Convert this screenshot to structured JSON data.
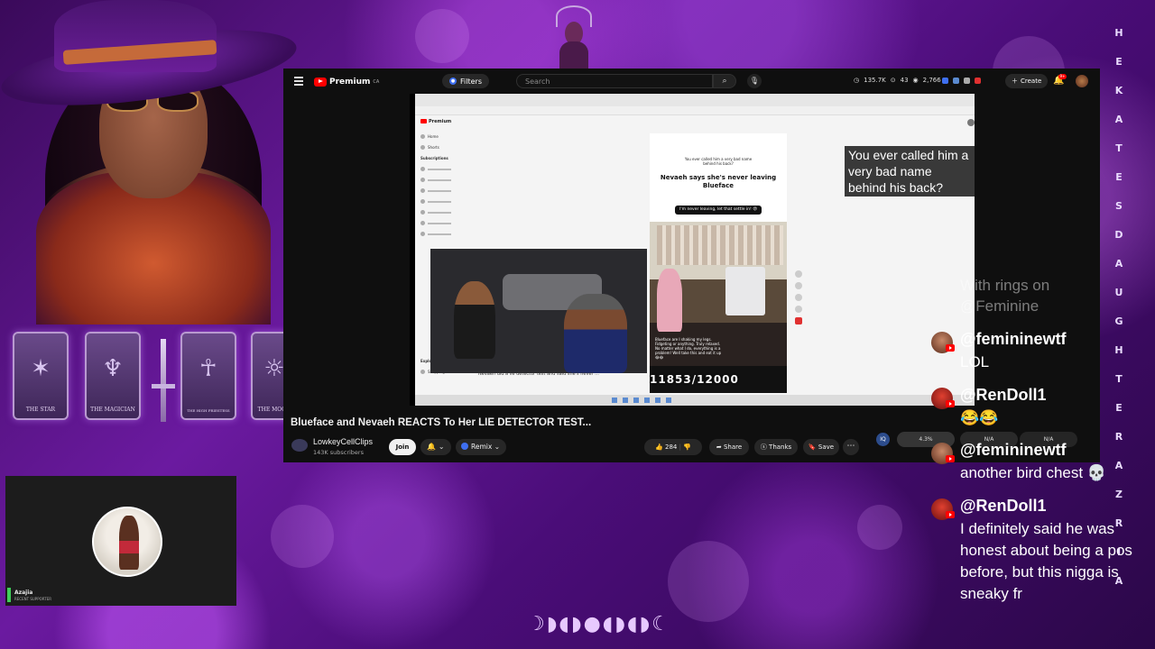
{
  "youtube": {
    "brand": "Premium",
    "region": "CA",
    "filters_label": "Filters",
    "search_placeholder": "Search",
    "stats": [
      "135.7K",
      "43",
      "2,766"
    ],
    "create_label": "Create",
    "notif_count": "9+",
    "video_title": "Blueface and Nevaeh REACTS To Her LIE DETECTOR TEST...",
    "channel_name": "LowkeyCellClips",
    "channel_subs": "143K subscribers",
    "join_label": "Join",
    "remix_label": "Remix",
    "like_count": "284",
    "share_label": "Share",
    "thanks_label": "Thanks",
    "save_label": "Save",
    "overlay_question": "You ever called him a very bad name behind his back?",
    "tiktok": {
      "small_header": "You ever called him a very bad name behind his back?",
      "title": "Nevaeh says she's never leaving Blueface",
      "pill": "I'm never leaving, let that settle in! 😡",
      "caption": "Blueface are I shaking my legs. Fidgeting or anything. Truly relaxed. No matter what I do, everything is a problem! Well take this and eat it up 😂😂",
      "counter": "11853/12000"
    },
    "reactor_caption": "Nevaeh did a lie detector test and said she's never ...",
    "sidebar": {
      "home": "Home",
      "shorts": "Shorts",
      "subscriptions": "Subscriptions",
      "explore": "Explore",
      "shopping": "Shopping"
    }
  },
  "widget": {
    "left_value": "4.3%",
    "mid1": "N/A",
    "mid2": "N/A"
  },
  "webcam": {
    "name": "Azajia",
    "sub": "RECENT SUPPORTER"
  },
  "chat": {
    "ghost_lines": [
      "With rings on",
      "@Feminine"
    ],
    "messages": [
      {
        "user": "@femininewtf",
        "text": "LOL",
        "avatar": "a"
      },
      {
        "user": "@RenDoll1",
        "text": "😂😂",
        "avatar": "b"
      },
      {
        "user": "@femininewtf",
        "text": "another bird chest 💀",
        "avatar": "a"
      },
      {
        "user": "@RenDoll1",
        "text": "I definitely said he was honest about being a pos before, but this nigga is sneaky fr",
        "avatar": "b"
      }
    ]
  },
  "banner_letters": [
    "H",
    "E",
    "K",
    "A",
    "T",
    "E",
    "S",
    "D",
    "A",
    "U",
    "G",
    "H",
    "T",
    "E",
    "R",
    "A",
    "Z",
    "R",
    "I",
    "A"
  ],
  "tarot": [
    "THE STAR",
    "THE MAGICIAN",
    "THE HIGH PRIESTESS",
    "THE MOON"
  ],
  "moon_phases": "☽◗◖◗●◖◗◖◗☾",
  "colors": {
    "background": "#4a0d78",
    "accent": "#ff0000",
    "chat_text": "#ffffff"
  }
}
